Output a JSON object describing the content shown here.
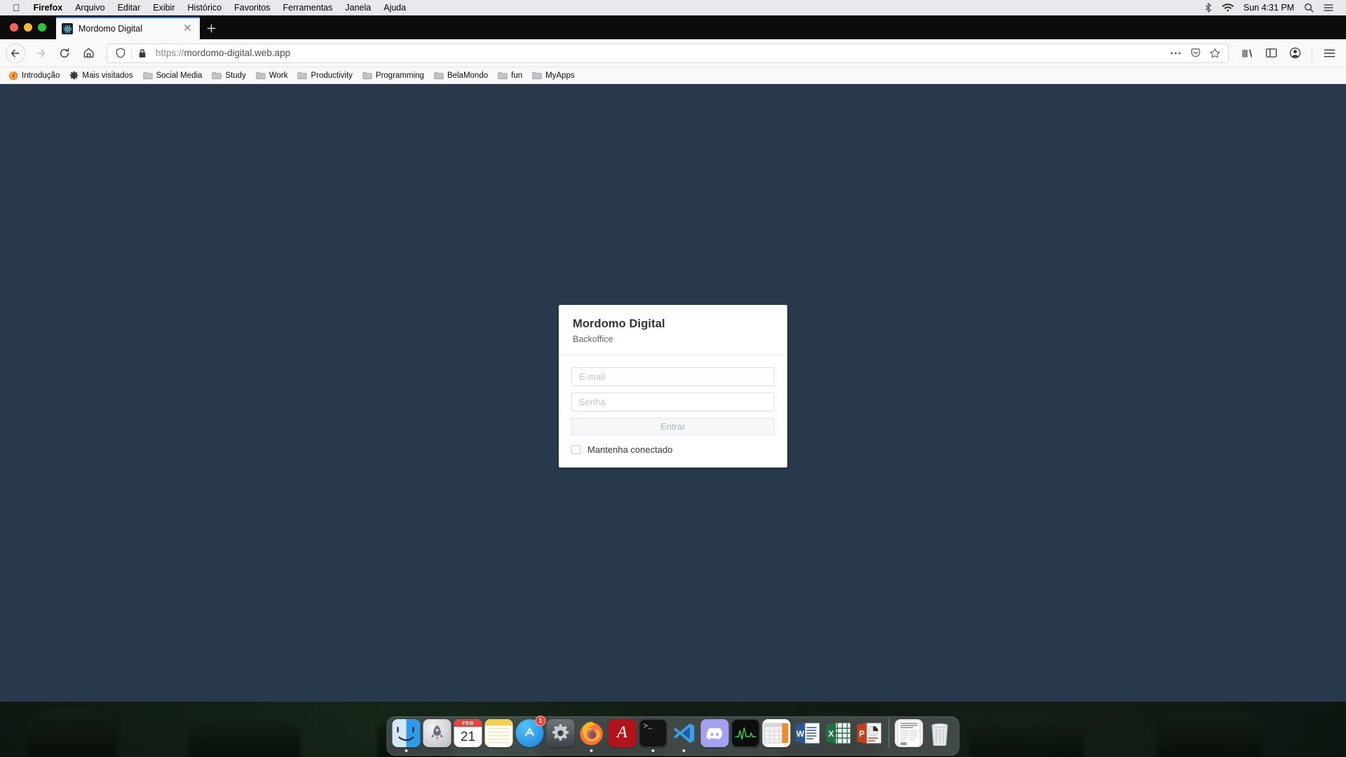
{
  "menubar": {
    "apple_icon": "apple-logo-icon",
    "items": [
      {
        "label": "Firefox",
        "bold": true
      },
      {
        "label": "Arquivo",
        "bold": false
      },
      {
        "label": "Editar",
        "bold": false
      },
      {
        "label": "Exibir",
        "bold": false
      },
      {
        "label": "Histórico",
        "bold": false
      },
      {
        "label": "Favoritos",
        "bold": false
      },
      {
        "label": "Ferramentas",
        "bold": false
      },
      {
        "label": "Janela",
        "bold": false
      },
      {
        "label": "Ajuda",
        "bold": false
      }
    ],
    "status": {
      "bluetooth_icon": "bluetooth-icon",
      "wifi_icon": "wifi-icon",
      "clock": "Sun 4:31 PM",
      "search_icon": "search-icon",
      "control_center_icon": "control-center-icon"
    }
  },
  "browser": {
    "window_controls": [
      "close",
      "minimize",
      "maximize"
    ],
    "tab": {
      "title": "Mordomo Digital",
      "favicon": "react-logo-icon",
      "close_icon": "close-icon"
    },
    "new_tab_label": "+",
    "toolbar": {
      "back_icon": "arrow-left-icon",
      "forward_icon": "arrow-right-icon",
      "reload_icon": "reload-icon",
      "home_icon": "home-icon",
      "library_icon": "library-icon",
      "sidebar_icon": "sidebar-icon",
      "account_icon": "account-icon",
      "menu_icon": "hamburger-menu-icon"
    },
    "urlbar": {
      "shield_icon": "tracking-protection-shield-icon",
      "lock_icon": "padlock-icon",
      "scheme": "https://",
      "host": "mordomo-digital.web.app",
      "page_actions_icon": "ellipsis-icon",
      "pocket_icon": "pocket-icon",
      "bookmark_star_icon": "star-icon"
    },
    "bookmarks": [
      {
        "label": "Introdução",
        "icon": "firefox-logo-icon"
      },
      {
        "label": "Mais visitados",
        "icon": "gear-icon"
      },
      {
        "label": "Social Media",
        "icon": "folder-icon"
      },
      {
        "label": "Study",
        "icon": "folder-icon"
      },
      {
        "label": "Work",
        "icon": "folder-icon"
      },
      {
        "label": "Productivity",
        "icon": "folder-icon"
      },
      {
        "label": "Programming",
        "icon": "folder-icon"
      },
      {
        "label": "BelaMondo",
        "icon": "folder-icon"
      },
      {
        "label": "fun",
        "icon": "folder-icon"
      },
      {
        "label": "MyApps",
        "icon": "folder-icon"
      }
    ]
  },
  "page": {
    "background_color": "#27394a",
    "login": {
      "title": "Mordomo Digital",
      "subtitle": "Backoffice",
      "email_placeholder": "E-mail",
      "email_value": "",
      "password_placeholder": "Senha",
      "password_value": "",
      "submit_label": "Entrar",
      "submit_disabled": true,
      "remember_label": "Mantenha conectado",
      "remember_checked": false
    }
  },
  "dock": {
    "items": [
      {
        "name": "finder",
        "label": "Finder",
        "running": true
      },
      {
        "name": "launchpad",
        "label": "Launchpad",
        "running": false
      },
      {
        "name": "calendar",
        "label": "Calendar",
        "running": false,
        "month": "FEB",
        "day": "21"
      },
      {
        "name": "notes",
        "label": "Notes",
        "running": false
      },
      {
        "name": "app-store",
        "label": "App Store",
        "running": false,
        "badge": "1"
      },
      {
        "name": "system-preferences",
        "label": "System Preferences",
        "running": false
      },
      {
        "name": "firefox",
        "label": "Firefox",
        "running": true
      },
      {
        "name": "acrobat-reader",
        "label": "Adobe Acrobat Reader",
        "running": false
      },
      {
        "name": "terminal",
        "label": "Terminal",
        "running": true
      },
      {
        "name": "vscode",
        "label": "Visual Studio Code",
        "running": true
      },
      {
        "name": "discord",
        "label": "Discord",
        "running": false
      },
      {
        "name": "activity-monitor",
        "label": "Activity Monitor",
        "running": false
      },
      {
        "name": "numbers",
        "label": "Numbers",
        "running": false
      },
      {
        "name": "word",
        "label": "Microsoft Word",
        "running": false,
        "glyph": "W"
      },
      {
        "name": "excel",
        "label": "Microsoft Excel",
        "running": false,
        "glyph": "X"
      },
      {
        "name": "powerpoint",
        "label": "Microsoft PowerPoint",
        "running": false,
        "glyph": "P"
      },
      {
        "name": "document",
        "label": "Document",
        "running": false
      },
      {
        "name": "trash",
        "label": "Trash",
        "running": false
      }
    ]
  }
}
